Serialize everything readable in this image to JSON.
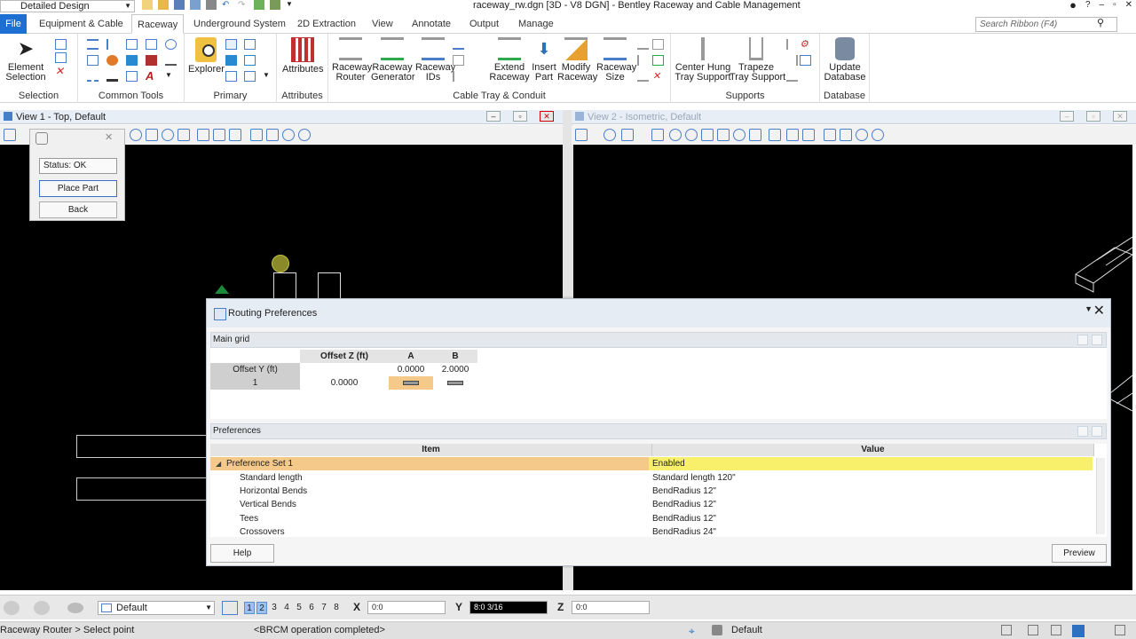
{
  "window": {
    "workflow": "Detailed Design",
    "title": "raceway_rw.dgn [3D - V8 DGN] - Bentley Raceway and Cable Management"
  },
  "tabs": [
    "File",
    "Equipment & Cable",
    "Raceway",
    "Underground System",
    "2D Extraction",
    "View",
    "Annotate",
    "Output",
    "Manage"
  ],
  "ribbon_search_placeholder": "Search Ribbon (F4)",
  "ribbon": {
    "selection": {
      "label": "Selection",
      "element_selection": "Element\nSelection"
    },
    "common_tools": {
      "label": "Common Tools"
    },
    "primary": {
      "label": "Primary",
      "explorer": "Explorer"
    },
    "attributes": {
      "label": "Attributes",
      "attributes": "Attributes"
    },
    "cable_tray": {
      "label": "Cable Tray & Conduit",
      "raceway_router": "Raceway\nRouter",
      "raceway_generator": "Raceway\nGenerator",
      "raceway_ids": "Raceway\nIDs",
      "extend_raceway": "Extend\nRaceway",
      "insert_part": "Insert\nPart",
      "modify_raceway": "Modify\nRaceway",
      "raceway_size": "Raceway\nSize"
    },
    "supports": {
      "label": "Supports",
      "center_hung": "Center Hung\nTray Support",
      "trapeze": "Trapeze\nTray Support"
    },
    "database": {
      "label": "Database",
      "update": "Update\nDatabase"
    }
  },
  "views": {
    "view1": "View 1 - Top, Default",
    "view2": "View 2 - Isometric, Default"
  },
  "tool_settings": {
    "status": "Status: OK",
    "place_part": "Place Part",
    "back": "Back"
  },
  "routing_preferences": {
    "title": "Routing Preferences",
    "main_grid": {
      "label": "Main grid",
      "col_offset_z": "Offset Z (ft)",
      "col_a": "A",
      "col_b": "B",
      "row_offset_y": "Offset Y (ft)",
      "offset_y_a": "0.0000",
      "offset_y_b": "2.0000",
      "row1": "1",
      "row1_offset_z": "0.0000"
    },
    "preferences": {
      "label": "Preferences",
      "col_item": "Item",
      "col_value": "Value",
      "rows": [
        {
          "item": "Preference Set 1",
          "value": "Enabled"
        },
        {
          "item": "Standard length",
          "value": "Standard length 120\""
        },
        {
          "item": "Horizontal Bends",
          "value": "BendRadius 12\""
        },
        {
          "item": "Vertical Bends",
          "value": "BendRadius 12\""
        },
        {
          "item": "Tees",
          "value": "BendRadius 12\""
        },
        {
          "item": "Crossovers",
          "value": "BendRadius 24\""
        }
      ]
    },
    "help": "Help",
    "preview": "Preview"
  },
  "statusbar": {
    "level": "Default",
    "view_numbers": [
      "1",
      "2",
      "3",
      "4",
      "5",
      "6",
      "7",
      "8"
    ],
    "x_label": "X",
    "x_value": "0:0",
    "y_label": "Y",
    "y_value": "8:0 3/16",
    "z_label": "Z",
    "z_value": "0:0",
    "prompt": "Raceway Router > Select point",
    "message": "<BRCM operation completed>",
    "active_level": "Default"
  }
}
